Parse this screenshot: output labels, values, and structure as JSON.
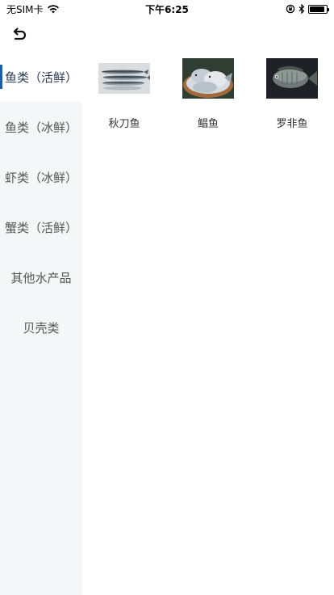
{
  "status_bar": {
    "carrier": "无SIM卡",
    "time": "下午6:25",
    "battery_percent": 90
  },
  "nav": {
    "back_icon": "undo-arrow-icon"
  },
  "sidebar": {
    "active_index": 0,
    "items": [
      {
        "label": "鱼类（活鲜）"
      },
      {
        "label": "鱼类（冰鲜）"
      },
      {
        "label": "虾类（冰鲜）"
      },
      {
        "label": "蟹类（活鲜）"
      },
      {
        "label": "其他水产品"
      },
      {
        "label": "贝壳类"
      }
    ]
  },
  "products": [
    {
      "name": "秋刀鱼",
      "image": "saury-fish"
    },
    {
      "name": "鲳鱼",
      "image": "pomfret-fish"
    },
    {
      "name": "罗非鱼",
      "image": "tilapia-fish"
    }
  ],
  "colors": {
    "accent": "#1f5e9e",
    "sidebar_bg": "#f5f6f8",
    "active_text": "#2b3a55"
  }
}
